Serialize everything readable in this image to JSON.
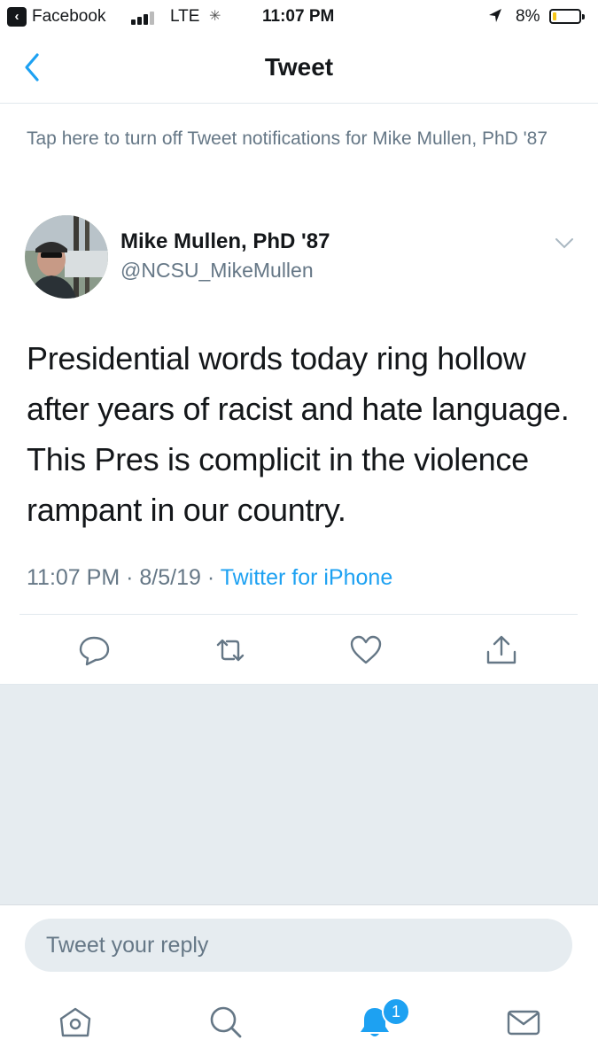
{
  "status_bar": {
    "back_app": "Facebook",
    "network": "LTE",
    "time": "11:07 PM",
    "battery_pct": "8%",
    "battery_level": 0.08,
    "colors": {
      "battery_fill": "#f5c518"
    }
  },
  "nav": {
    "title": "Tweet",
    "back_icon": "chevron-left-icon"
  },
  "notification_banner": "Tap here to turn off Tweet notifications for Mike Mullen, PhD '87",
  "tweet": {
    "author_name": "Mike Mullen, PhD '87",
    "handle": "@NCSU_MikeMullen",
    "text": "Presidential words today ring hollow after years of racist and hate language.  This Pres is complicit in the violence rampant in our country.",
    "time": "11:07 PM",
    "separator": "·",
    "date": "8/5/19",
    "source": "Twitter for iPhone",
    "actions": [
      "reply-icon",
      "retweet-icon",
      "like-icon",
      "share-icon"
    ]
  },
  "reply": {
    "placeholder": "Tweet your reply"
  },
  "tabbar": {
    "items": [
      "home-icon",
      "search-icon",
      "notifications-icon",
      "messages-icon"
    ],
    "notification_badge": "1"
  },
  "colors": {
    "accent": "#1da1f2",
    "secondary_text": "#657786",
    "divider": "#e1e8ed",
    "background_gray": "#e6ecf0"
  }
}
